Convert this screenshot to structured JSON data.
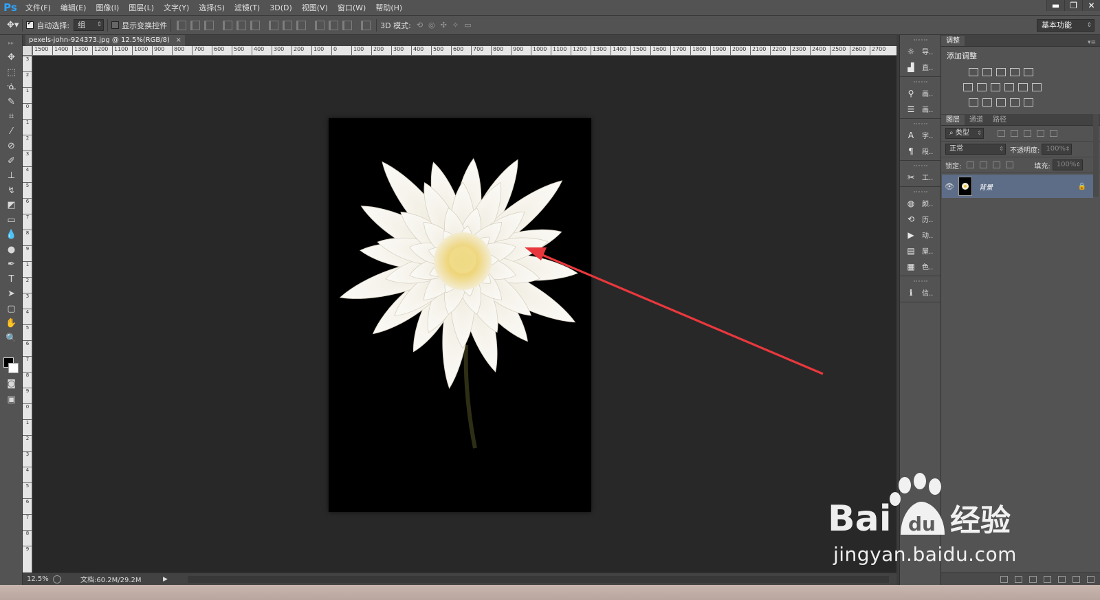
{
  "app": {
    "logo": "Ps"
  },
  "menu": [
    "文件(F)",
    "编辑(E)",
    "图像(I)",
    "图层(L)",
    "文字(Y)",
    "选择(S)",
    "滤镜(T)",
    "3D(D)",
    "视图(V)",
    "窗口(W)",
    "帮助(H)"
  ],
  "window_controls": {
    "minimize": "▬",
    "restore": "❐",
    "close": "✕"
  },
  "options": {
    "auto_select_label": "自动选择:",
    "auto_select_checked": true,
    "auto_select_value": "组",
    "show_transform_label": "显示变换控件",
    "mode3d_label": "3D 模式:",
    "workspace": "基本功能"
  },
  "document": {
    "tab_title": "pexels-john-924373.jpg @ 12.5%(RGB/8)",
    "tab_close": "×",
    "zoom": "12.5%",
    "doc_size": "文档:60.2M/29.2M",
    "status_arrow": "▶"
  },
  "ruler": {
    "h_ticks": [
      "1500",
      "1400",
      "1300",
      "1200",
      "1100",
      "1000",
      "900",
      "800",
      "700",
      "600",
      "500",
      "400",
      "300",
      "200",
      "100",
      "0",
      "100",
      "200",
      "300",
      "400",
      "500",
      "600",
      "700",
      "800",
      "900",
      "1000",
      "1100",
      "1200",
      "1300",
      "1400",
      "1500",
      "1600",
      "1700",
      "1800",
      "1900",
      "2000",
      "2100",
      "2200",
      "2300",
      "2400",
      "2500",
      "2600",
      "2700"
    ],
    "v_ticks": [
      "3",
      "2",
      "1",
      "0",
      "1",
      "2",
      "3",
      "4",
      "5",
      "6",
      "7",
      "8",
      "9",
      "1",
      "2",
      "3",
      "4",
      "5",
      "6",
      "7",
      "8",
      "9",
      "0",
      "1",
      "2",
      "3",
      "4",
      "5",
      "6",
      "7",
      "8",
      "9"
    ]
  },
  "icon_panel": [
    {
      "icon": "☼",
      "label": "导.."
    },
    {
      "icon": "▟",
      "label": "直.."
    },
    {
      "icon": "⚲",
      "label": "画.."
    },
    {
      "icon": "☰",
      "label": "画.."
    },
    {
      "icon": "A",
      "label": "字.."
    },
    {
      "icon": "¶",
      "label": "段.."
    },
    {
      "icon": "✂",
      "label": "工.."
    },
    {
      "icon": "◍",
      "label": "颜.."
    },
    {
      "icon": "⟲",
      "label": "历.."
    },
    {
      "icon": "▶",
      "label": "动.."
    },
    {
      "icon": "▤",
      "label": "屋.."
    },
    {
      "icon": "▦",
      "label": "色.."
    },
    {
      "icon": "ℹ",
      "label": "信.."
    }
  ],
  "adjustments": {
    "tab": "调整",
    "title": "添加调整"
  },
  "layers": {
    "tabs": [
      "图层",
      "通道",
      "路径"
    ],
    "filter_kind": "类型",
    "blend_mode": "正常",
    "opacity_label": "不透明度:",
    "opacity_value": "100%",
    "lock_label": "锁定:",
    "fill_label": "填充:",
    "fill_value": "100%",
    "items": [
      {
        "name": "背景",
        "visible": true,
        "locked": true
      }
    ]
  },
  "watermark": {
    "brand": "Bai",
    "brand2": "du",
    "cn": "经验",
    "url": "jingyan.baidu.com"
  },
  "colors": {
    "canvas_bg": "#282828",
    "ui_panel": "#535353",
    "selected_layer": "#5d6d88",
    "arrow": "#e8383d"
  }
}
